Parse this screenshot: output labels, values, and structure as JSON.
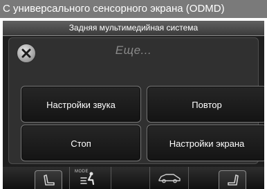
{
  "caption": "С универсального сенсорного экрана (ODMD)",
  "screen": {
    "title": "Задняя мультимедийная система",
    "panel_title": "Еще...",
    "close_icon": "close-icon",
    "buttons": {
      "sound_settings": "Настройки звука",
      "repeat": "Повтор",
      "stop": "Стоп",
      "display_settings": "Настройки экрана"
    }
  },
  "bottom_bar": {
    "mode_label": "MODE",
    "icons": [
      "seat-left-icon",
      "airflow-mode-icon",
      "car-icon",
      "seat-right-icon"
    ]
  },
  "colors": {
    "caption_bg": "#7a7a7a",
    "screen_bg": "#1e1e1e",
    "button_border": "#7a7a7a",
    "panel_title": "#8a8a8a"
  }
}
